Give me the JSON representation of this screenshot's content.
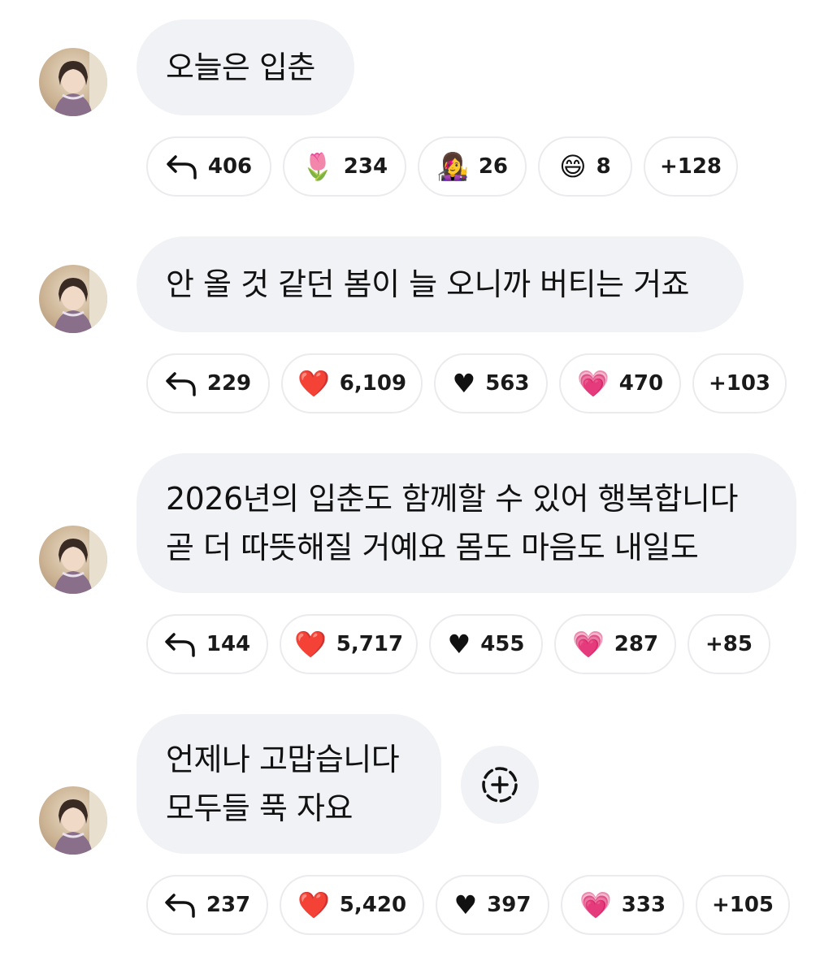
{
  "messages": [
    {
      "lines": [
        "오늘은 입춘"
      ],
      "reactions": [
        {
          "icon": "reply-icon",
          "glyph": "",
          "count": "406"
        },
        {
          "icon": "tulip-icon",
          "glyph": "🌷",
          "count": "234"
        },
        {
          "icon": "woman-singer-icon",
          "glyph": "👩‍🎤",
          "count": "26"
        },
        {
          "icon": "grinning-face-icon",
          "glyph": "😄",
          "count": "8"
        },
        {
          "icon": "",
          "glyph": "",
          "count": "+128"
        }
      ]
    },
    {
      "lines": [
        "안 올 것 같던 봄이 늘 오니까 버티는 거죠"
      ],
      "reactions": [
        {
          "icon": "reply-icon",
          "glyph": "",
          "count": "229"
        },
        {
          "icon": "red-heart-icon",
          "glyph": "❤️",
          "count": "6,109"
        },
        {
          "icon": "black-heart-icon",
          "glyph": "♥",
          "count": "563"
        },
        {
          "icon": "pink-heart-icon",
          "glyph": "💗",
          "count": "470"
        },
        {
          "icon": "",
          "glyph": "",
          "count": "+103"
        }
      ]
    },
    {
      "lines": [
        "2026년의 입춘도 함께할 수 있어 행복합니다",
        "곧 더 따뜻해질 거예요 몸도 마음도 내일도"
      ],
      "reactions": [
        {
          "icon": "reply-icon",
          "glyph": "",
          "count": "144"
        },
        {
          "icon": "red-heart-icon",
          "glyph": "❤️",
          "count": "5,717"
        },
        {
          "icon": "black-heart-icon",
          "glyph": "♥",
          "count": "455"
        },
        {
          "icon": "pink-heart-icon",
          "glyph": "💗",
          "count": "287"
        },
        {
          "icon": "",
          "glyph": "",
          "count": "+85"
        }
      ]
    },
    {
      "lines": [
        "언제나 고맙습니다",
        "모두들 푹 자요"
      ],
      "reactions": [
        {
          "icon": "reply-icon",
          "glyph": "",
          "count": "237"
        },
        {
          "icon": "red-heart-icon",
          "glyph": "❤️",
          "count": "5,420"
        },
        {
          "icon": "black-heart-icon",
          "glyph": "♥",
          "count": "397"
        },
        {
          "icon": "pink-heart-icon",
          "glyph": "💗",
          "count": "333"
        },
        {
          "icon": "",
          "glyph": "",
          "count": "+105"
        }
      ]
    }
  ],
  "add_reaction": {
    "icon": "add-reaction-icon"
  },
  "colors": {
    "bubble_bg": "#f1f2f5",
    "pill_border": "#ebebee",
    "text": "#111111"
  }
}
